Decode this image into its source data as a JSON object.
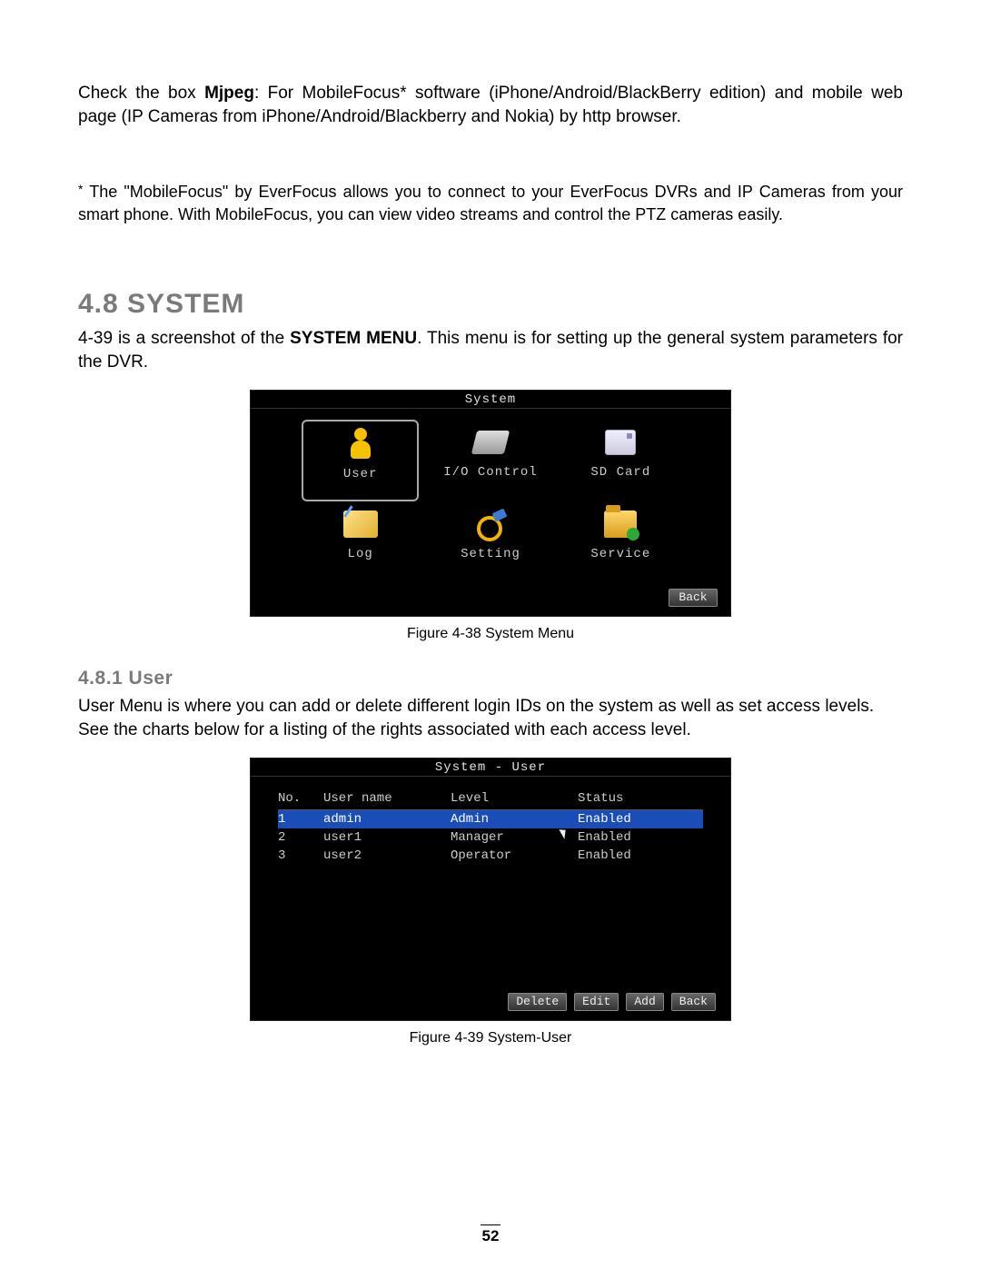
{
  "para1_pre": "Check the box ",
  "para1_bold": "Mjpeg",
  "para1_post": ": For MobileFocus* software (iPhone/Android/BlackBerry edition) and mobile web page (IP Cameras from iPhone/Android/Blackberry and Nokia) by http browser.",
  "note_star": "*",
  "note_text": " The \"MobileFocus\" by EverFocus allows you to connect to your EverFocus DVRs and IP Cameras from your smart phone.  With MobileFocus, you can view video streams and control the PTZ cameras easily.",
  "h1": "4.8  SYSTEM",
  "para2_pre": "4-39 is a screenshot of the ",
  "para2_bold": "SYSTEM MENU",
  "para2_post": ". This menu is for setting up the general system parameters for the DVR.",
  "fig1_caption": "Figure 4-38 System Menu",
  "h2": "4.8.1  User",
  "para3": "User Menu is where you can add or delete different login IDs on the system as well as set access levels. See the charts below for a listing of the rights associated with each access level.",
  "fig2_caption": "Figure 4-39 System-User",
  "page_number": "52",
  "ss1": {
    "title": "System",
    "back": "Back",
    "items": [
      {
        "label": "User",
        "selected": true
      },
      {
        "label": "I/O Control",
        "selected": false
      },
      {
        "label": "SD Card",
        "selected": false
      },
      {
        "label": "Log",
        "selected": false
      },
      {
        "label": "Setting",
        "selected": false
      },
      {
        "label": "Service",
        "selected": false
      }
    ]
  },
  "ss2": {
    "title": "System - User",
    "headers": {
      "no": "No.",
      "user": "User name",
      "level": "Level",
      "status": "Status"
    },
    "rows": [
      {
        "no": "1",
        "user": "admin",
        "level": "Admin",
        "status": "Enabled",
        "selected": true
      },
      {
        "no": "2",
        "user": "user1",
        "level": "Manager",
        "status": "Enabled",
        "selected": false
      },
      {
        "no": "3",
        "user": "user2",
        "level": "Operator",
        "status": "Enabled",
        "selected": false
      }
    ],
    "buttons": {
      "delete": "Delete",
      "edit": "Edit",
      "add": "Add",
      "back": "Back"
    }
  }
}
